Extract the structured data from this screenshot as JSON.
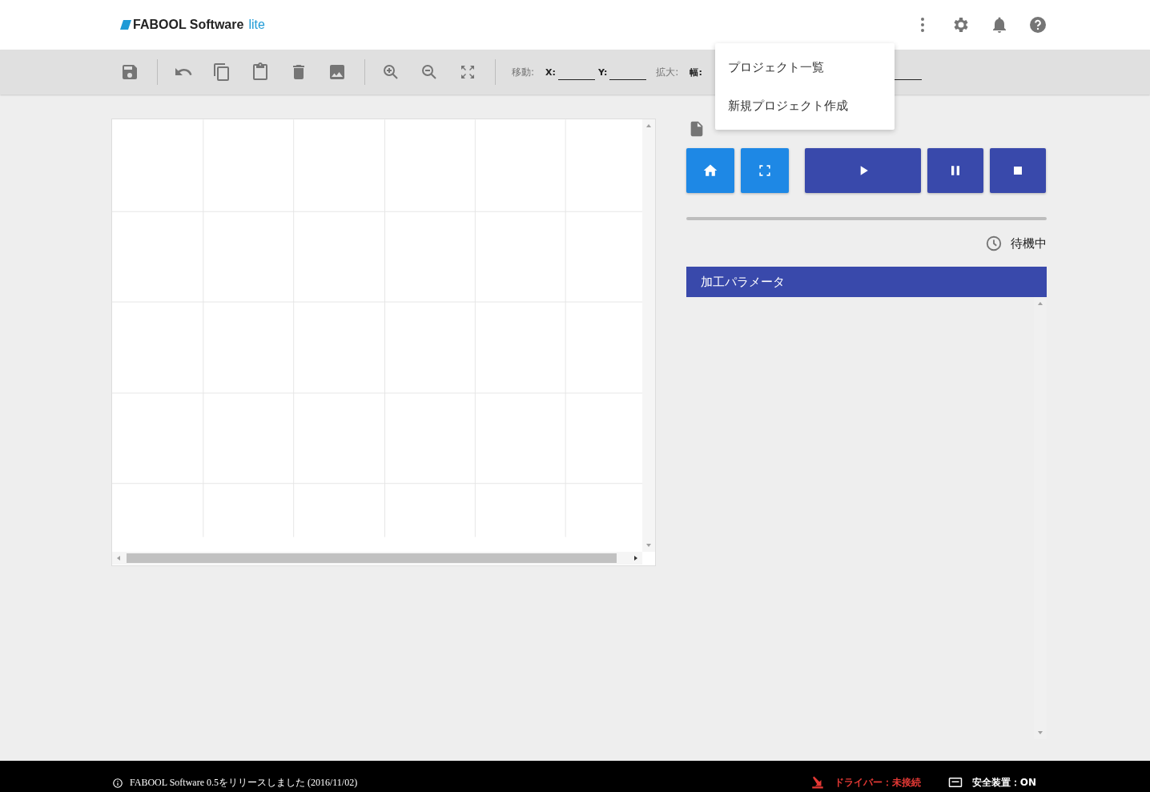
{
  "app": {
    "brand": "FABOOL Software",
    "edition": "lite"
  },
  "toolbar": {
    "move_label": "移動:",
    "move_fields": [
      {
        "label": "X:"
      },
      {
        "label": "Y:"
      }
    ],
    "scale_label": "拡大:",
    "scale_fields": [
      {
        "label": "幅:"
      }
    ]
  },
  "menu": {
    "items": [
      {
        "label": "プロジェクト一覧"
      },
      {
        "label": "新規プロジェクト作成"
      }
    ]
  },
  "controls": [
    {
      "kind": "home",
      "color": "#1e88e5"
    },
    {
      "kind": "frame",
      "color": "#1e88e5"
    },
    {
      "kind": "play",
      "color": "#3949ab"
    },
    {
      "kind": "pause",
      "color": "#3949ab"
    },
    {
      "kind": "stop",
      "color": "#3949ab"
    }
  ],
  "status": {
    "label": "待機中"
  },
  "params_panel": {
    "title": "加工パラメータ"
  },
  "footer": {
    "message": "FABOOL Software 0.5をリリースしました (2016/11/02)",
    "driver": {
      "label": "ドライバー：未接続",
      "connected": false
    },
    "safety": {
      "label": "安全装置：ON"
    }
  }
}
